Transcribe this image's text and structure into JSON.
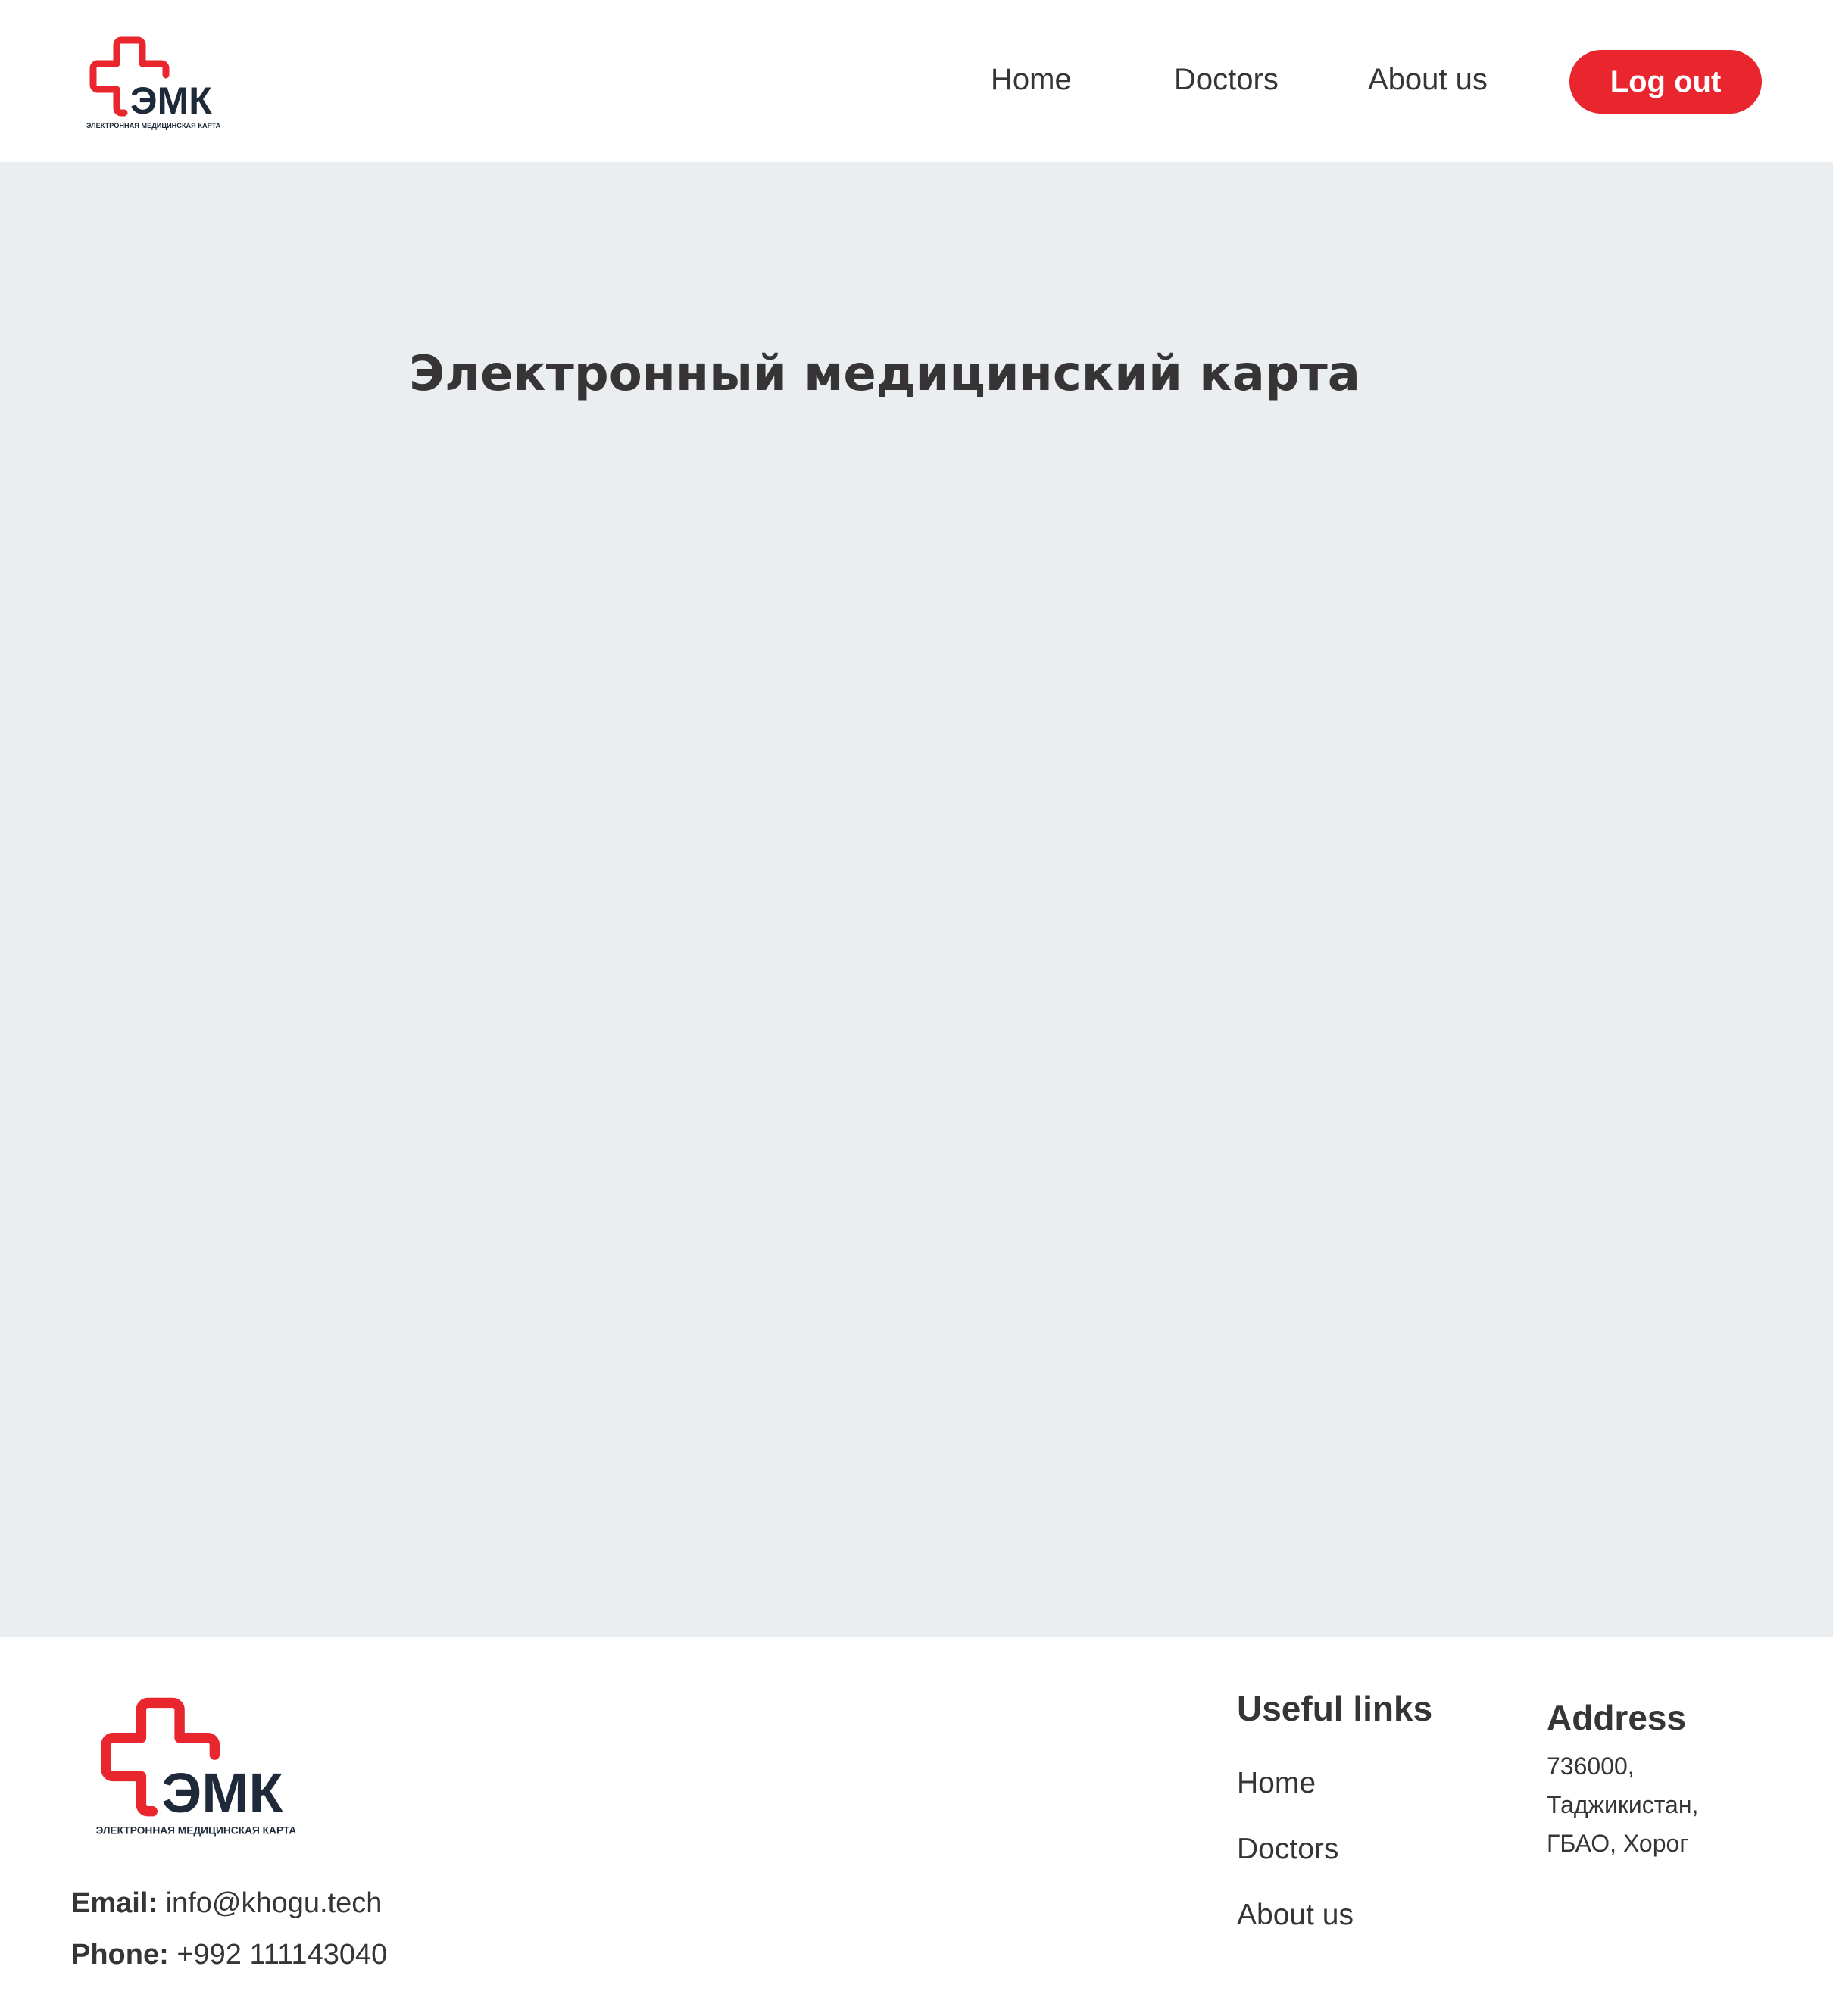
{
  "header": {
    "logo": {
      "text": "ЭМК",
      "subtitle": "ЭЛЕКТРОННАЯ МЕДИЦИНСКАЯ КАРТА",
      "icon": "medical-cross-icon"
    },
    "nav": {
      "home": "Home",
      "doctors": "Doctors",
      "about": "About us"
    },
    "logout_label": "Log out"
  },
  "main": {
    "title": "Электронный медицинский карта"
  },
  "footer": {
    "logo": {
      "text": "ЭМК",
      "subtitle": "ЭЛЕКТРОННАЯ МЕДИЦИНСКАЯ КАРТА"
    },
    "contact": {
      "email_label": "Email:",
      "email_value": "info@khogu.tech",
      "phone_label": "Phone:",
      "phone_value": "+992 111143040"
    },
    "useful_links": {
      "title": "Useful links",
      "home": "Home",
      "doctors": "Doctors",
      "about": "About us"
    },
    "address": {
      "title": "Address",
      "lines": [
        "736000,",
        "Таджикистан,",
        "ГБАО, Хорог"
      ]
    }
  },
  "colors": {
    "accent": "#e9262e",
    "text": "#373435",
    "logo_text": "#1e2a3a",
    "main_background": "#ebeef1"
  }
}
